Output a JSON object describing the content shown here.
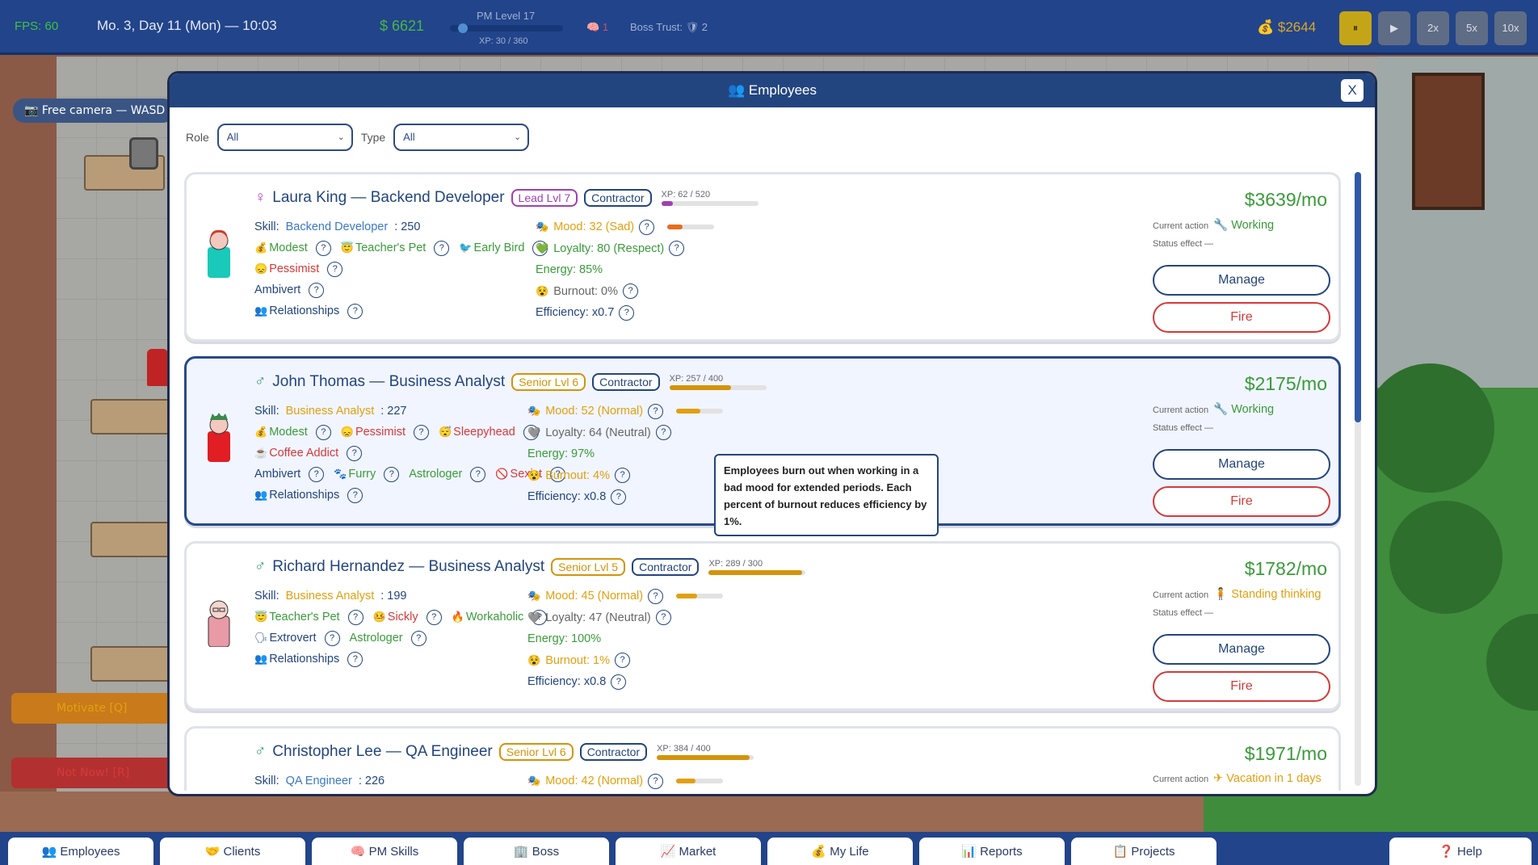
{
  "hud": {
    "fps": "FPS: 60",
    "date": "Mo. 3, Day 11 (Mon) — 10:03",
    "money": "$ 6621",
    "pm_level": "PM Level 17",
    "pm_xp": "XP: 30 / 360",
    "pm_progress": 0.08,
    "brain": "1",
    "boss_trust": "Boss Trust: 🛡 2",
    "gold": "$2644",
    "speeds": [
      "⏸",
      "▶",
      "2x",
      "5x",
      "10x"
    ]
  },
  "left_panel": {
    "free_camera": "📷 Free camera — WASD",
    "motivate": "Motivate [Q]",
    "not_now": "Not Now! [R]"
  },
  "modal": {
    "title": "👥 Employees",
    "close": "X",
    "role_label": "Role",
    "role_value": "All",
    "type_label": "Type",
    "type_value": "All"
  },
  "labels": {
    "current_action": "Current action",
    "status_effect": "Status effect",
    "status_value": "—",
    "manage": "Manage",
    "fire": "Fire",
    "relationships": "Relationships"
  },
  "employees": [
    {
      "sex": "♀",
      "name": "Laura King — Backend Developer",
      "level": "Lead  Lvl 7",
      "type": "Contractor",
      "xp": "XP: 62 / 520",
      "xp_fraction": 0.12,
      "skill_label": "Skill:",
      "skill_name": "Backend Developer",
      "skill_value": ": 250",
      "mood": "Mood: 32 (Sad)",
      "mood_fraction": 0.32,
      "loyalty": "Loyalty: 80 (Respect)",
      "energy": "Energy: 85%",
      "burnout": "Burnout: 0%",
      "efficiency": "Efficiency: x0.7",
      "salary": "$3639/mo",
      "action": "Working",
      "traits_row1": [
        "Modest",
        "Teacher's Pet",
        "Early Bird"
      ],
      "traits_row2": [
        "Pessimist"
      ],
      "traits_row3": [
        "Ambivert"
      ]
    },
    {
      "sex": "♂",
      "name": "John Thomas — Business Analyst",
      "level": "Senior  Lvl 6",
      "type": "Contractor",
      "xp": "XP: 257 / 400",
      "xp_fraction": 0.64,
      "skill_label": "Skill:",
      "skill_name": "Business Analyst",
      "skill_value": ": 227",
      "mood": "Mood: 52 (Normal)",
      "mood_fraction": 0.52,
      "loyalty": "Loyalty: 64 (Neutral)",
      "energy": "Energy: 97%",
      "burnout": "Burnout: 4%",
      "efficiency": "Efficiency: x0.8",
      "salary": "$2175/mo",
      "action": "Working",
      "traits_row1": [
        "Modest",
        "Pessimist",
        "Sleepyhead"
      ],
      "traits_row2": [
        "Coffee Addict"
      ],
      "traits_row3": [
        "Ambivert",
        "Furry",
        "Astrologer",
        "Sexist"
      ]
    },
    {
      "sex": "♂",
      "name": "Richard Hernandez — Business Analyst",
      "level": "Senior  Lvl 5",
      "type": "Contractor",
      "xp": "XP: 289 / 300",
      "xp_fraction": 0.96,
      "skill_label": "Skill:",
      "skill_name": "Business Analyst",
      "skill_value": ": 199",
      "mood": "Mood: 45 (Normal)",
      "mood_fraction": 0.45,
      "loyalty": "Loyalty: 47 (Neutral)",
      "energy": "Energy: 100%",
      "burnout": "Burnout: 1%",
      "efficiency": "Efficiency: x0.8",
      "salary": "$1782/mo",
      "action": "Standing thinking",
      "traits_row1": [
        "Teacher's Pet",
        "Sickly",
        "Workaholic"
      ],
      "traits_row2": [
        "Extrovert",
        "Astrologer"
      ]
    },
    {
      "sex": "♂",
      "name": "Christopher Lee — QA Engineer",
      "level": "Senior  Lvl 6",
      "type": "Contractor",
      "xp": "XP: 384 / 400",
      "xp_fraction": 0.96,
      "skill_label": "Skill:",
      "skill_name": "QA Engineer",
      "skill_value": ": 226",
      "mood": "Mood: 42 (Normal)",
      "mood_fraction": 0.42,
      "salary": "$1971/mo",
      "action": "Vacation in 1 days"
    }
  ],
  "tooltip": "Employees burn out when working in a bad mood for extended periods. Each percent of burnout reduces efficiency by 1%.",
  "bottom_tabs": [
    "👥 Employees",
    "🤝 Clients",
    "🧠 PM Skills",
    "🏢 Boss",
    "📈 Market",
    "💰 My Life",
    "📊 Reports",
    "📋 Projects",
    "❓ Help"
  ],
  "colors": {
    "accent": "#23457f",
    "green": "#3a9b3a",
    "red": "#d43a3a",
    "orange": "#e2a00f",
    "lead": "#a040b3"
  }
}
